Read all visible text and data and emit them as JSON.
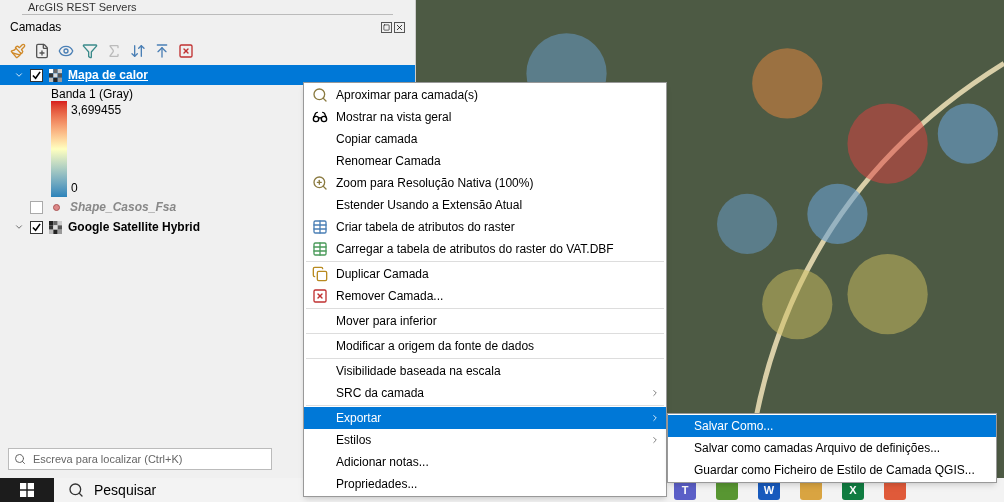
{
  "browser_item": {
    "label": "ArcGIS REST Servers"
  },
  "panel": {
    "title": "Camadas"
  },
  "layers": [
    {
      "name": "Mapa de calor",
      "kind": "raster",
      "checked": true,
      "expanded": true,
      "selected": true,
      "legend": {
        "band": "Banda 1 (Gray)",
        "max": "3,699455",
        "min": "0"
      }
    },
    {
      "name": "Shape_Casos_Fsa",
      "kind": "points",
      "checked": false,
      "selected": false
    },
    {
      "name": "Google Satellite Hybrid",
      "kind": "tiles",
      "checked": true,
      "expanded": true,
      "selected": false
    }
  ],
  "locator": {
    "placeholder": "Escreva para localizar (Ctrl+K)"
  },
  "context_menu": {
    "items": [
      {
        "label": "Aproximar para camada(s)",
        "kind": "zoom",
        "selected": false
      },
      {
        "label": "Mostrar na vista geral",
        "kind": "overview",
        "selected": false
      },
      {
        "label": "Copiar camada",
        "kind": "plain",
        "selected": false
      },
      {
        "label": "Renomear Camada",
        "kind": "plain",
        "selected": false
      },
      {
        "label": "Zoom para Resolução Nativa (100%)",
        "kind": "native",
        "selected": false
      },
      {
        "label": "Estender Usando a Extensão Atual",
        "kind": "plain",
        "selected": false
      },
      {
        "label": "Criar tabela de atributos do raster",
        "kind": "table",
        "selected": false
      },
      {
        "label": "Carregar a tabela de atributos do raster do VAT.DBF",
        "kind": "table-add",
        "selected": false
      },
      {
        "label": "Duplicar Camada",
        "kind": "duplicate",
        "selected": false,
        "divider_before": true
      },
      {
        "label": "Remover Camada...",
        "kind": "remove",
        "selected": false
      },
      {
        "label": "Mover para inferior",
        "kind": "plain",
        "selected": false,
        "divider_before": true
      },
      {
        "label": "Modificar a origem da fonte de dados",
        "kind": "plain",
        "selected": false,
        "divider_before": true
      },
      {
        "label": "Visibilidade baseada na escala",
        "kind": "plain",
        "selected": false,
        "divider_before": true
      },
      {
        "label": "SRC da camada",
        "kind": "submenu",
        "selected": false
      },
      {
        "label": "Exportar",
        "kind": "submenu",
        "selected": true,
        "divider_before": true
      },
      {
        "label": "Estilos",
        "kind": "submenu",
        "selected": false
      },
      {
        "label": "Adicionar notas...",
        "kind": "plain",
        "selected": false
      },
      {
        "label": "Propriedades...",
        "kind": "plain",
        "selected": false
      }
    ]
  },
  "submenu": {
    "items": [
      {
        "label": "Salvar Como...",
        "selected": true
      },
      {
        "label": "Salvar como camadas Arquivo de definições...",
        "selected": false
      },
      {
        "label": "Guardar como Ficheiro de Estilo de Camada QGIS...",
        "selected": false
      }
    ]
  },
  "taskbar": {
    "search": "Pesquisar",
    "apps": [
      {
        "glyph": "T",
        "color": "#5b5fc7"
      },
      {
        "color": "#589632"
      },
      {
        "glyph": "W",
        "color": "#185abd"
      },
      {
        "color": "#d9a441"
      },
      {
        "glyph": "X",
        "color": "#107c41"
      },
      {
        "color": "#e05a3a"
      }
    ]
  }
}
